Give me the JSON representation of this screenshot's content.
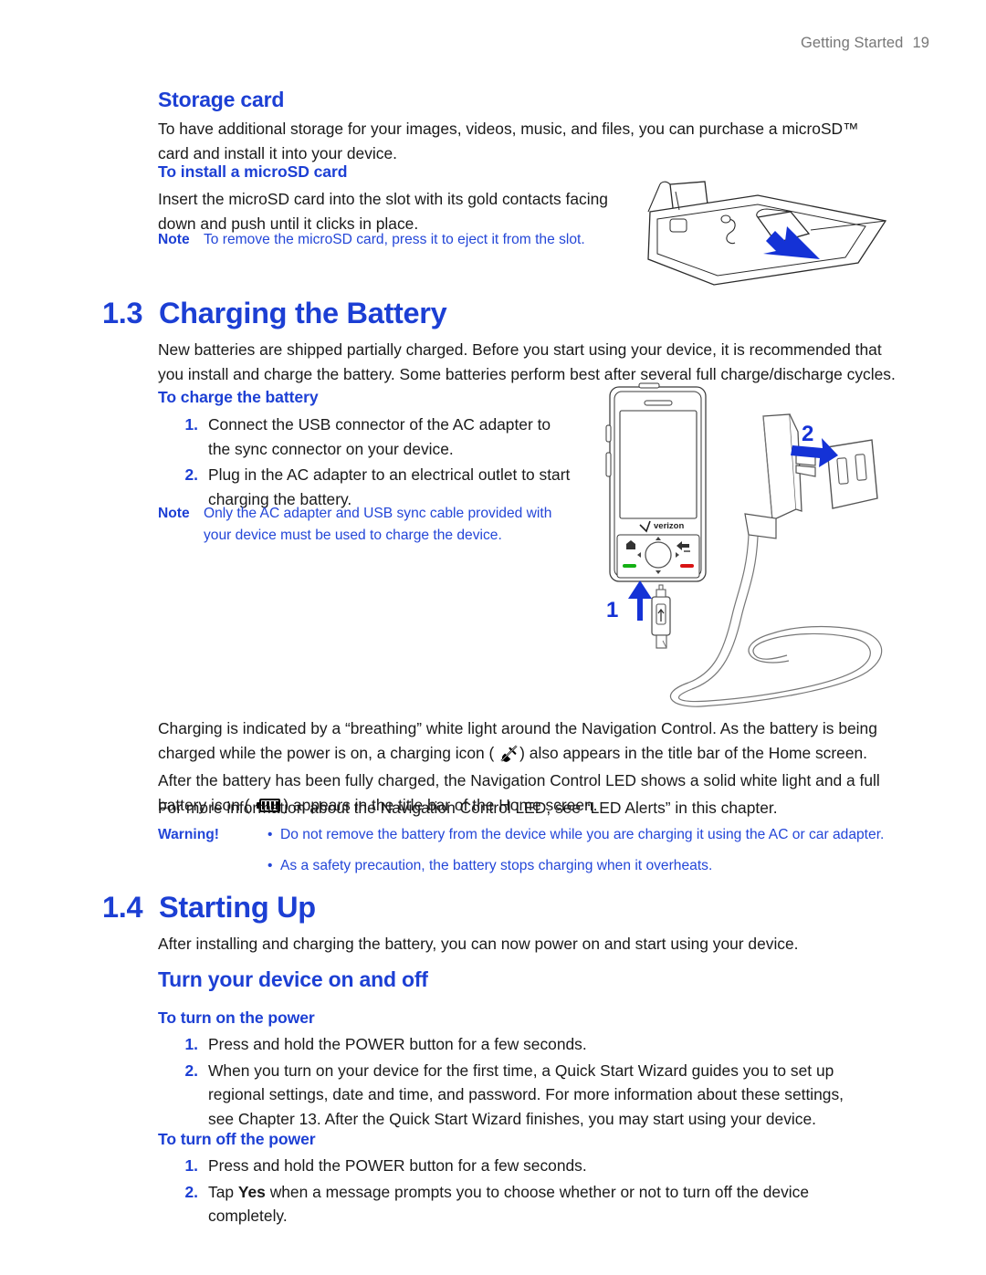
{
  "header": {
    "chapter": "Getting Started",
    "page_number": "19"
  },
  "storage_card": {
    "heading": "Storage card",
    "intro": "To have additional storage for your images, videos, music, and files, you can purchase a microSD™ card and install it into your device.",
    "subheading": "To install a microSD card",
    "instruction": "Insert the microSD card into the slot with its gold contacts facing down and push until it clicks in place.",
    "note_label": "Note",
    "note_text": "To remove the microSD card, press it to eject it from the slot."
  },
  "section_1_3": {
    "number": "1.3",
    "title": "Charging the Battery",
    "intro": "New batteries are shipped partially charged. Before you start using your device, it is recommended that you install and charge the battery. Some batteries perform best after several full charge/discharge cycles.",
    "subheading": "To charge the battery",
    "steps": [
      {
        "n": "1.",
        "text": "Connect the USB connector of the AC adapter to the sync connector on your device."
      },
      {
        "n": "2.",
        "text": "Plug in the AC adapter to an electrical outlet to start charging the battery."
      }
    ],
    "note_label": "Note",
    "note_text": "Only the AC adapter and USB sync cable provided with your device must be used to charge the device.",
    "charging_para_1": "Charging is indicated by a “breathing” white light around the Navigation Control. As the battery is being charged while the power is on, a charging icon (",
    "charging_para_2": ") also appears in the title bar of the Home screen. After the battery has been fully charged, the Navigation Control LED shows a solid white light and a full battery icon (",
    "charging_para_3": ") appears in the title bar of the Home screen.",
    "led_para": "For more information about the Navigation Control LED, see “LED Alerts” in this chapter.",
    "warning_label": "Warning!",
    "warning_items": [
      "Do not remove the battery from the device while you are charging it using the AC or car adapter.",
      "As a safety precaution, the battery stops charging when it overheats."
    ],
    "illustration": {
      "callout_1": "1",
      "callout_2": "2",
      "device_brand": "verizon"
    }
  },
  "section_1_4": {
    "number": "1.4",
    "title": "Starting Up",
    "intro": "After installing and charging the battery, you can now power on and start using your device.",
    "subheading": "Turn your device on and off",
    "turn_on": {
      "heading": "To turn on the power",
      "steps": [
        {
          "n": "1.",
          "text": "Press and hold the POWER button for a few seconds."
        },
        {
          "n": "2.",
          "text": "When you turn on your device for the first time, a Quick Start Wizard guides you to set up regional settings, date and time, and password. For more information about these settings, see Chapter 13. After the Quick Start Wizard finishes, you may start using your device."
        }
      ]
    },
    "turn_off": {
      "heading": "To turn off the power",
      "step_1": {
        "n": "1.",
        "text": "Press and hold the POWER button for a few seconds."
      },
      "step_2": {
        "n": "2.",
        "prefix": "Tap ",
        "bold": "Yes",
        "suffix": " when a message prompts you to choose whether or not to turn off the device completely."
      }
    }
  },
  "colors": {
    "accent_blue": "#1c3fd4",
    "note_blue": "#2346d8",
    "header_gray": "#777777",
    "body_black": "#1a1a1a"
  }
}
